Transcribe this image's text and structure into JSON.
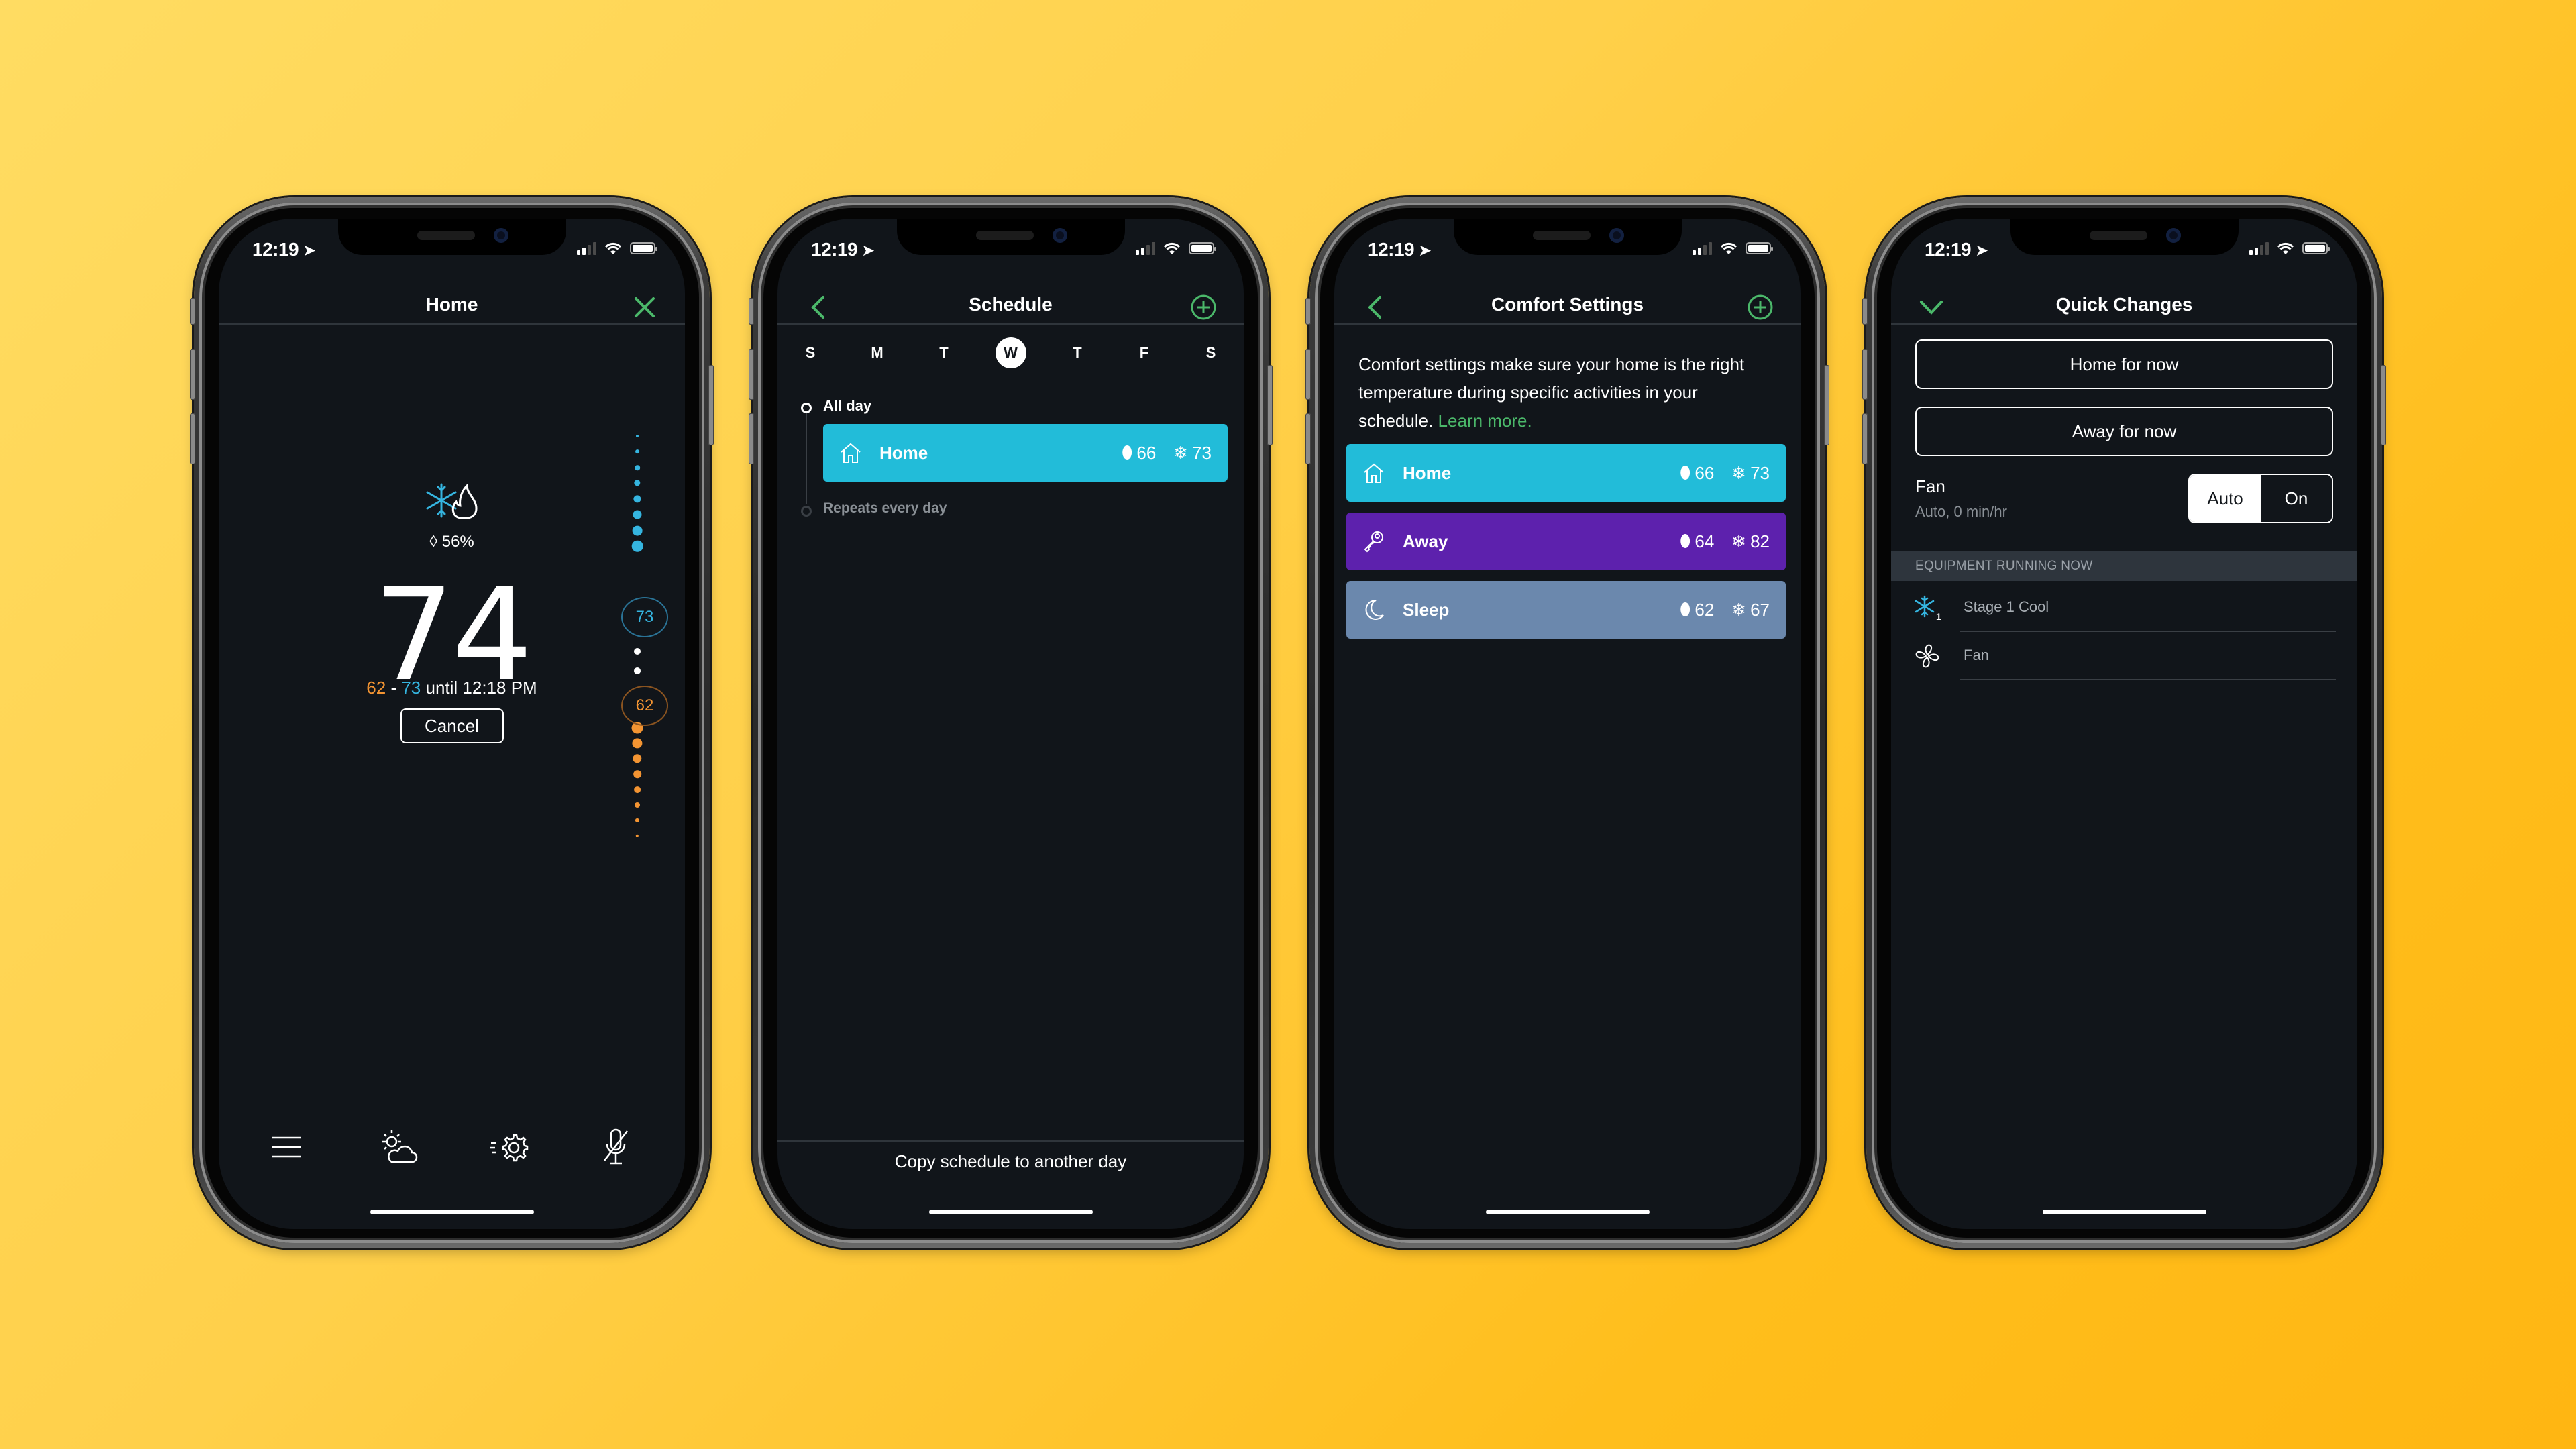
{
  "background": {
    "gradient_start": "#ffdc62",
    "gradient_end": "#ffb612"
  },
  "colors": {
    "accent_green": "#4bb86a",
    "screen_bg": "#11151a",
    "cool_blue": "#35b5e0",
    "heat_orange": "#f39432",
    "home_bar": "#22bcd9",
    "away_bar": "#5d21ad",
    "sleep_bar": "#6b88ad"
  },
  "status_bar": {
    "time": "12:19",
    "location_icon": "location-arrow-icon",
    "signal_bars": 2,
    "battery_level": 1.0
  },
  "phones": [
    {
      "screen": "home",
      "header": {
        "title": "Home",
        "right_icon": "close-icon"
      },
      "mode_icon": "cool-heat-icon",
      "humidity": "56%",
      "current_temp": "74",
      "hold": {
        "heat": "62",
        "separator": "-",
        "cool": "73",
        "until_text": "until 12:18 PM"
      },
      "cancel_label": "Cancel",
      "setpoints": {
        "cool": "73",
        "heat": "62"
      },
      "bottom_nav": [
        {
          "icon": "menu-icon",
          "label": "Menu"
        },
        {
          "icon": "weather-icon",
          "label": "Weather"
        },
        {
          "icon": "quick-settings-icon",
          "label": "Quick Changes"
        },
        {
          "icon": "mic-off-icon",
          "label": "Alexa"
        }
      ]
    },
    {
      "screen": "schedule",
      "header": {
        "title": "Schedule",
        "left_icon": "back-chevron-icon",
        "right_icon": "add-circle-icon"
      },
      "days": [
        {
          "label": "S",
          "selected": false
        },
        {
          "label": "M",
          "selected": false
        },
        {
          "label": "T",
          "selected": false
        },
        {
          "label": "W",
          "selected": true
        },
        {
          "label": "T",
          "selected": false
        },
        {
          "label": "F",
          "selected": false
        },
        {
          "label": "S",
          "selected": false
        }
      ],
      "timeline": {
        "start_label": "All day",
        "entry": {
          "name": "Home",
          "icon": "house-icon",
          "heat": "66",
          "cool": "73"
        },
        "end_label": "Repeats every day"
      },
      "footer_label": "Copy schedule to another day"
    },
    {
      "screen": "comfort_settings",
      "header": {
        "title": "Comfort Settings",
        "left_icon": "back-chevron-icon",
        "right_icon": "add-circle-icon"
      },
      "description": "Comfort settings make sure your home is the right temperature during specific activities in your schedule.",
      "learn_more": "Learn more.",
      "settings": [
        {
          "name": "Home",
          "icon": "house-icon",
          "heat": "66",
          "cool": "73",
          "color": "#22bcd9"
        },
        {
          "name": "Away",
          "icon": "key-icon",
          "heat": "64",
          "cool": "82",
          "color": "#5d21ad"
        },
        {
          "name": "Sleep",
          "icon": "moon-icon",
          "heat": "62",
          "cool": "67",
          "color": "#6b88ad"
        }
      ]
    },
    {
      "screen": "quick_changes",
      "header": {
        "title": "Quick Changes",
        "left_icon": "chevron-down-icon"
      },
      "buttons": {
        "home_for_now": "Home for now",
        "away_for_now": "Away for now"
      },
      "fan": {
        "label": "Fan",
        "status": "Auto, 0 min/hr",
        "options": [
          "Auto",
          "On"
        ],
        "selected": "Auto"
      },
      "equipment": {
        "header": "EQUIPMENT RUNNING NOW",
        "items": [
          {
            "icon": "stage1-cool-icon",
            "label": "Stage 1 Cool",
            "stage": "1"
          },
          {
            "icon": "fan-icon",
            "label": "Fan"
          }
        ]
      }
    }
  ]
}
